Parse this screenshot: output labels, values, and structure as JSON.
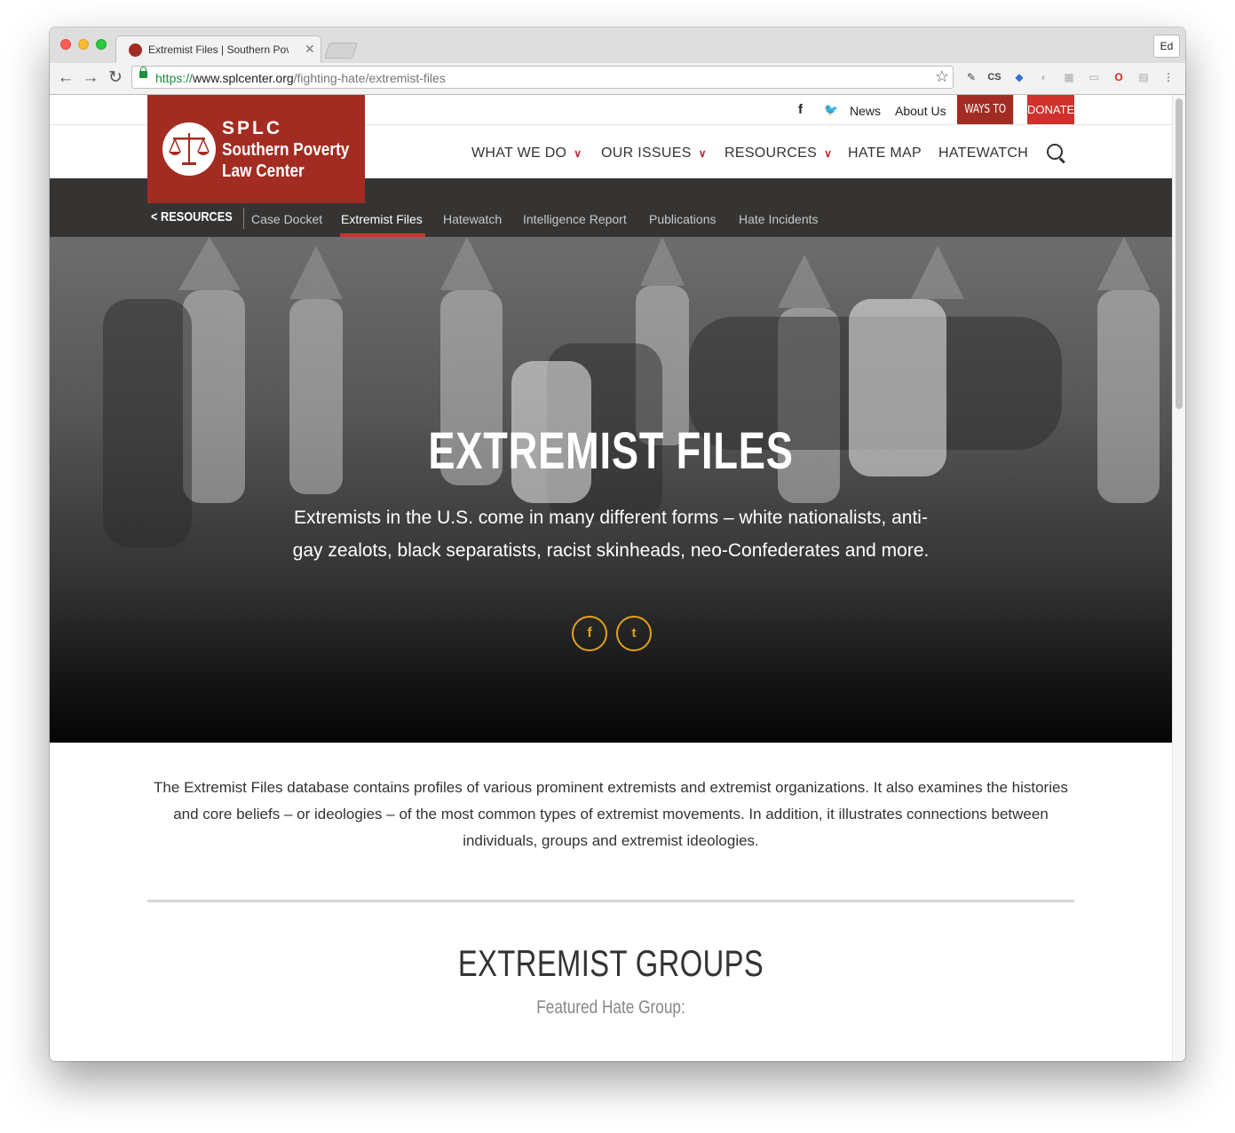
{
  "browser": {
    "tab_title": "Extremist Files | Southern Pov",
    "profile": "Ed",
    "url_proto": "https://",
    "url_host": "www.splcenter.org",
    "url_path": "/fighting-hate/extremist-files",
    "extensions": [
      "pin",
      "CS",
      "shield",
      "ghost",
      "qr",
      "cast",
      "opera",
      "reader"
    ]
  },
  "utility_nav": {
    "links": [
      "News",
      "About Us"
    ],
    "ways_to_give": "WAYS TO GIVE",
    "donate": "DONATE"
  },
  "logo": {
    "splc": "SPLC",
    "name_line1": "Southern Poverty",
    "name_line2": "Law Center"
  },
  "main_nav": {
    "items": [
      "WHAT WE DO",
      "OUR ISSUES",
      "RESOURCES",
      "HATE MAP",
      "HATEWATCH"
    ]
  },
  "sub_nav": {
    "back": "RESOURCES",
    "items": [
      "Case Docket",
      "Extremist Files",
      "Hatewatch",
      "Intelligence Report",
      "Publications",
      "Hate Incidents"
    ],
    "active": "Extremist Files"
  },
  "hero": {
    "title": "EXTREMIST FILES",
    "text": "Extremists in the U.S. come in many different forms – white nationalists, anti-gay zealots, black separatists, racist skinheads, neo-Confederates and more."
  },
  "intro": "The Extremist Files database contains profiles of various prominent extremists and extremist organizations. It also examines the histories and core beliefs – or ideologies – of the most common types of extremist movements. In addition, it illustrates connections between individuals, groups and extremist ideologies.",
  "groups": {
    "title": "EXTREMIST GROUPS",
    "subtitle": "Featured Hate Group:"
  },
  "colors": {
    "brand_red": "#a32c22",
    "donate_red": "#d0312d",
    "accent_gold": "#e3a21a",
    "subnav_bg": "#363432"
  }
}
